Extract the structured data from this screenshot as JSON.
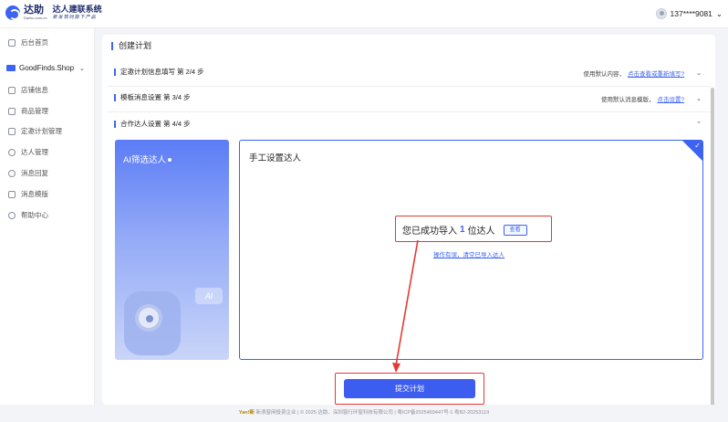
{
  "topbar": {
    "logo_main": "达助",
    "logo_sub": "Dazhu.com.cn",
    "product_title": "达人建联系统",
    "product_slogan": "新发现同旗下产品",
    "user_phone": "137****9081",
    "user_chevron": "⌄"
  },
  "sidebar": {
    "home": "后台首页",
    "shop_name": "GoodFinds.Shop",
    "items": [
      {
        "label": "店铺信息",
        "icon": "store-icon"
      },
      {
        "label": "商品管理",
        "icon": "goods-icon"
      },
      {
        "label": "定邀计划管理",
        "icon": "plan-icon"
      },
      {
        "label": "达人管理",
        "icon": "user-icon"
      },
      {
        "label": "消息回复",
        "icon": "message-icon"
      },
      {
        "label": "消息模版",
        "icon": "template-icon"
      },
      {
        "label": "帮助中心",
        "icon": "help-icon"
      }
    ]
  },
  "main": {
    "page_title": "创建计划",
    "sections": [
      {
        "title": "定邀计划信息填写 第 2/4 步",
        "hint": "使用默认内容，",
        "link": "点击查看或重新填写?"
      },
      {
        "title": "模板消息设置 第 3/4 步",
        "hint": "使用默认消息模版，",
        "link": "点击设置?"
      },
      {
        "title": "合作达人设置 第 4/4 步"
      }
    ],
    "ai_panel": {
      "title": "AI筛选达人",
      "tag": "AI"
    },
    "manual_panel": {
      "title": "手工设置达人",
      "import_prefix": "您已成功导入",
      "import_count": "1",
      "import_suffix": "位达人",
      "view_button": "查看",
      "reimport_link": "操作有误，清空已导入达人"
    },
    "submit_label": "提交计划"
  },
  "footer": {
    "brand": "Yan!新",
    "text": "新浪窗闲投资企业 | © 2025 达助、深圳窗行环窗科技有限公司 | 粤ICP备2025469447号-1 粤B2-20253119"
  },
  "colors": {
    "accent": "#3d63f3",
    "highlight": "#e53935"
  }
}
